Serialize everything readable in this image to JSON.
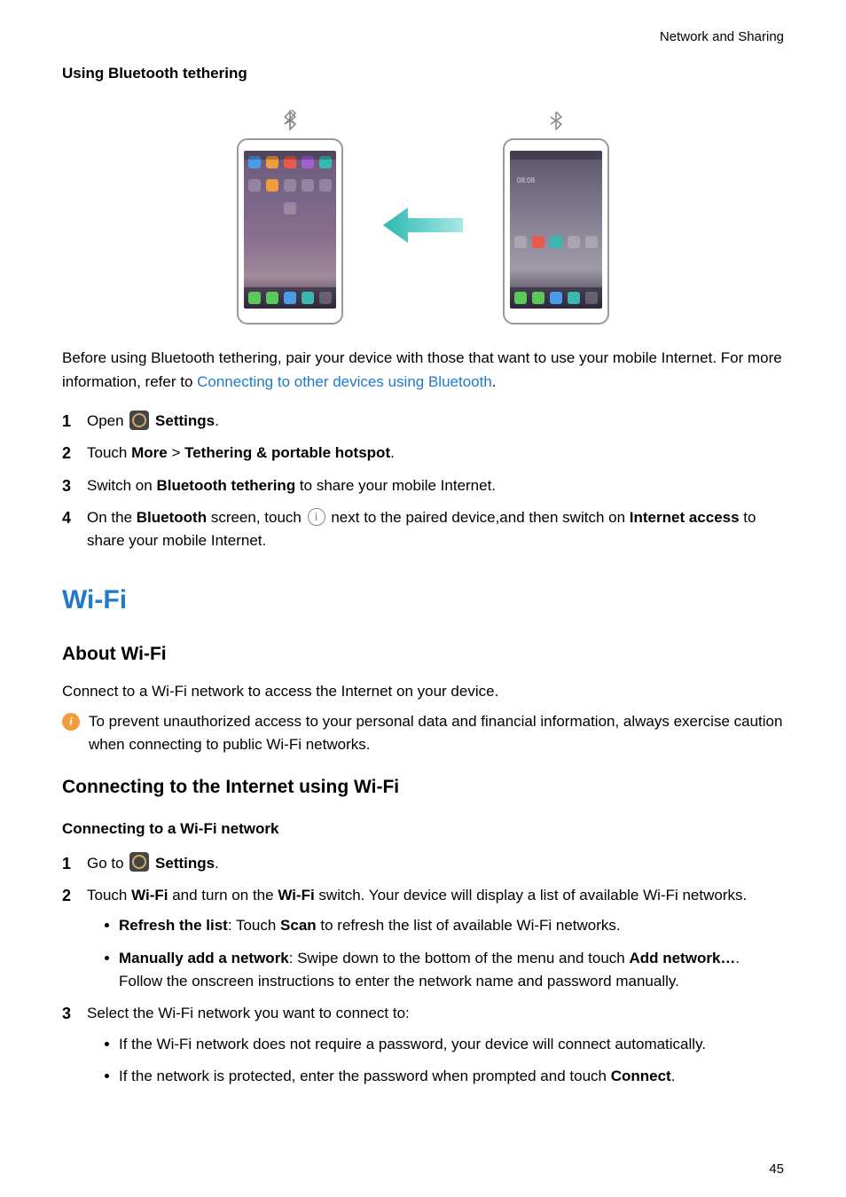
{
  "header": {
    "breadcrumb": "Network and Sharing"
  },
  "bt_tether": {
    "title": "Using Bluetooth tethering",
    "intro_a": "Before using Bluetooth tethering, pair your device with those that want to use your mobile Internet. For more information, refer to ",
    "intro_link": "Connecting to other devices using Bluetooth",
    "intro_b": ".",
    "steps": {
      "s1_a": "Open ",
      "s1_b": "Settings",
      "s1_c": ".",
      "s2_a": "Touch ",
      "s2_b": "More",
      "s2_c": " > ",
      "s2_d": "Tethering & portable hotspot",
      "s2_e": ".",
      "s3_a": "Switch on ",
      "s3_b": "Bluetooth tethering",
      "s3_c": " to share your mobile Internet.",
      "s4_a": "On the ",
      "s4_b": "Bluetooth",
      "s4_c": " screen, touch ",
      "s4_d": " next to the paired device,and then switch on ",
      "s4_e": "Internet access",
      "s4_f": " to share your mobile Internet."
    }
  },
  "wifi": {
    "heading": "Wi-Fi",
    "about_h": "About Wi-Fi",
    "about_p": "Connect to a Wi-Fi network to access the Internet on your device.",
    "note": "To prevent unauthorized access to your personal data and financial information, always exercise caution when connecting to public Wi-Fi networks.",
    "connect_h": "Connecting to the Internet using Wi-Fi",
    "connect_sub": "Connecting to a Wi-Fi network",
    "steps": {
      "s1_a": "Go to ",
      "s1_b": "Settings",
      "s1_c": ".",
      "s2_a": "Touch ",
      "s2_b": "Wi-Fi",
      "s2_c": " and turn on the ",
      "s2_d": "Wi-Fi",
      "s2_e": " switch. Your device will display a list of available Wi-Fi networks.",
      "b1_a": "Refresh the list",
      "b1_b": ": Touch ",
      "b1_c": "Scan",
      "b1_d": " to refresh the list of available Wi-Fi networks.",
      "b2_a": "Manually add a network",
      "b2_b": ": Swipe down to the bottom of the menu and touch ",
      "b2_c": "Add network…",
      "b2_d": ". Follow the onscreen instructions to enter the network name and password manually.",
      "s3": "Select the Wi-Fi network you want to connect to:",
      "b3": "If the Wi-Fi network does not require a password, your device will connect automatically.",
      "b4_a": "If the network is protected, enter the password when prompted and touch ",
      "b4_b": "Connect",
      "b4_c": "."
    }
  },
  "page_number": "45"
}
